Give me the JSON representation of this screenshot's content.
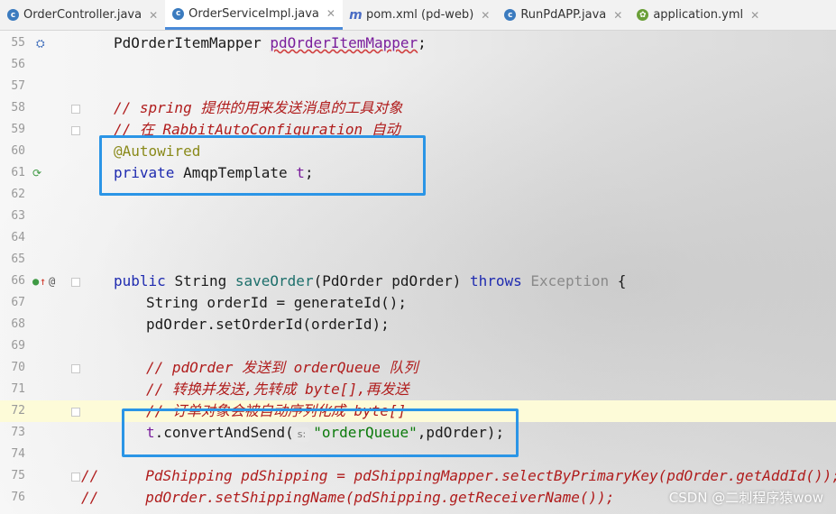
{
  "tabs": [
    {
      "name": "OrderController.java",
      "icon": "java-class-icon"
    },
    {
      "name": "OrderServiceImpl.java",
      "icon": "java-class-icon",
      "active": true
    },
    {
      "name": "pom.xml (pd-web)",
      "icon": "maven-icon"
    },
    {
      "name": "RunPdAPP.java",
      "icon": "run-class-icon"
    },
    {
      "name": "application.yml",
      "icon": "spring-yml-icon"
    }
  ],
  "line_numbers": [
    "55",
    "56",
    "57",
    "58",
    "59",
    "60",
    "61",
    "62",
    "63",
    "64",
    "65",
    "66",
    "67",
    "68",
    "69",
    "70",
    "71",
    "72",
    "73",
    "74",
    "75",
    "76"
  ],
  "code": {
    "l55": {
      "type": "PdOrderItemMapper ",
      "field": "pdOrderItemMapper",
      "end": ";"
    },
    "l58": {
      "comment": "// spring 提供的用来发送消息的工具对象"
    },
    "l59": {
      "comment": "// 在 RabbitAutoConfiguration 自动"
    },
    "l60": {
      "annotation": "@Autowired"
    },
    "l61": {
      "kw": "private ",
      "type": "AmqpTemplate ",
      "field": "t",
      "end": ";"
    },
    "l66": {
      "kw": "public ",
      "type": "String ",
      "method": "saveOrder",
      "params": "(PdOrder pdOrder) ",
      "throws": "throws ",
      "exc": "Exception",
      "end": " {"
    },
    "l67": {
      "text": "String orderId = generateId();"
    },
    "l68": {
      "text": "pdOrder.setOrderId(orderId);"
    },
    "l70": {
      "comment": "// pdOrder 发送到 orderQueue 队列"
    },
    "l71": {
      "comment": "// 转换并发送,先转成 byte[],再发送"
    },
    "l72": {
      "comment": "// 订单对象会被自动序列化成 byte[]"
    },
    "l73": {
      "obj": "t",
      "call": ".convertAndSend(",
      "hint": "s:",
      "str": "\"orderQueue\"",
      "rest": ",pdOrder);"
    },
    "l75": {
      "prefix": "//",
      "comment": "PdShipping pdShipping = pdShippingMapper.selectByPrimaryKey(pdOrder.getAddId());"
    },
    "l76": {
      "prefix": "//",
      "comment": "pdOrder.setShippingName(pdShipping.getReceiverName());"
    }
  },
  "watermark": "CSDN @二刺程序猿wow",
  "colors": {
    "box": "#2b95e6",
    "tab_active": "#4a8ad8",
    "current_line": "#fdfbd8"
  }
}
